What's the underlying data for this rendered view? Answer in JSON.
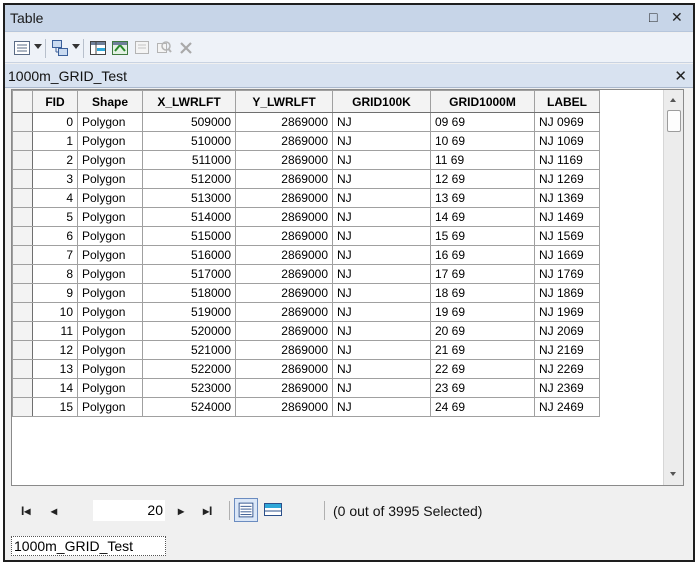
{
  "window": {
    "title": "Table",
    "restore_glyph": "□",
    "close_glyph": "✕"
  },
  "toolbar": {
    "icons": [
      "table-options-icon",
      "related-tables-icon",
      "select-by-attributes-icon",
      "switch-selection-icon",
      "clear-selection-icon",
      "zoom-to-selected-icon",
      "delete-selected-icon"
    ]
  },
  "tab": {
    "name": "1000m_GRID_Test",
    "close_glyph": "✕"
  },
  "columns": [
    "FID",
    "Shape",
    "X_LWRLFT",
    "Y_LWRLFT",
    "GRID100K",
    "GRID1000M",
    "LABEL"
  ],
  "rows": [
    [
      "0",
      "Polygon",
      "509000",
      "2869000",
      "NJ",
      "09 69",
      "NJ 0969"
    ],
    [
      "1",
      "Polygon",
      "510000",
      "2869000",
      "NJ",
      "10 69",
      "NJ 1069"
    ],
    [
      "2",
      "Polygon",
      "511000",
      "2869000",
      "NJ",
      "11 69",
      "NJ 1169"
    ],
    [
      "3",
      "Polygon",
      "512000",
      "2869000",
      "NJ",
      "12 69",
      "NJ 1269"
    ],
    [
      "4",
      "Polygon",
      "513000",
      "2869000",
      "NJ",
      "13 69",
      "NJ 1369"
    ],
    [
      "5",
      "Polygon",
      "514000",
      "2869000",
      "NJ",
      "14 69",
      "NJ 1469"
    ],
    [
      "6",
      "Polygon",
      "515000",
      "2869000",
      "NJ",
      "15 69",
      "NJ 1569"
    ],
    [
      "7",
      "Polygon",
      "516000",
      "2869000",
      "NJ",
      "16 69",
      "NJ 1669"
    ],
    [
      "8",
      "Polygon",
      "517000",
      "2869000",
      "NJ",
      "17 69",
      "NJ 1769"
    ],
    [
      "9",
      "Polygon",
      "518000",
      "2869000",
      "NJ",
      "18 69",
      "NJ 1869"
    ],
    [
      "10",
      "Polygon",
      "519000",
      "2869000",
      "NJ",
      "19 69",
      "NJ 1969"
    ],
    [
      "11",
      "Polygon",
      "520000",
      "2869000",
      "NJ",
      "20 69",
      "NJ 2069"
    ],
    [
      "12",
      "Polygon",
      "521000",
      "2869000",
      "NJ",
      "21 69",
      "NJ 2169"
    ],
    [
      "13",
      "Polygon",
      "522000",
      "2869000",
      "NJ",
      "22 69",
      "NJ 2269"
    ],
    [
      "14",
      "Polygon",
      "523000",
      "2869000",
      "NJ",
      "23 69",
      "NJ 2369"
    ],
    [
      "15",
      "Polygon",
      "524000",
      "2869000",
      "NJ",
      "24 69",
      "NJ 2469"
    ]
  ],
  "nav": {
    "first_glyph": "I◂",
    "prev_glyph": "◂",
    "next_glyph": "▸",
    "last_glyph": "▸I",
    "current_record": "20",
    "selection_info": "(0 out of 3995 Selected)"
  },
  "bottom_tab": {
    "label": "1000m_GRID_Test"
  }
}
